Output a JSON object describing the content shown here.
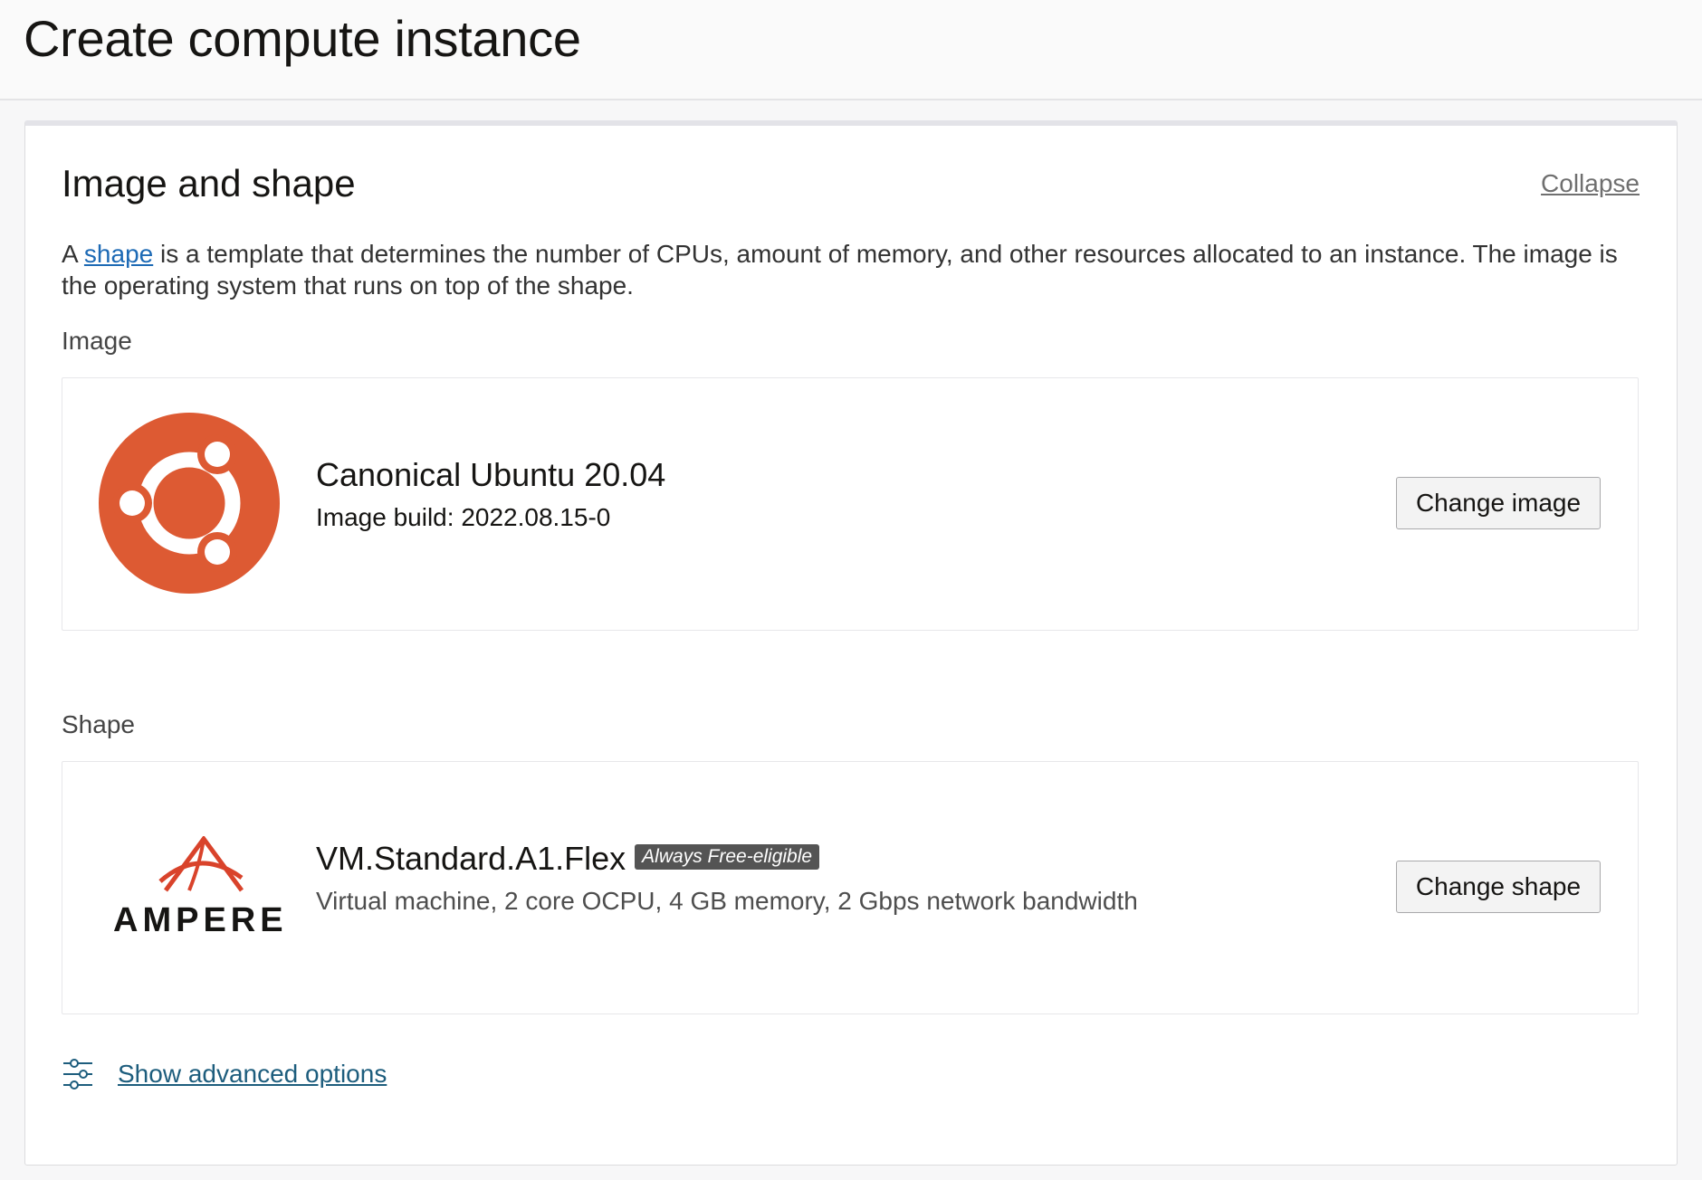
{
  "header": {
    "title": "Create compute instance"
  },
  "section": {
    "title": "Image and shape",
    "collapse_label": "Collapse",
    "description_prefix": "A ",
    "description_link": "shape",
    "description_suffix": " is a template that determines the number of CPUs, amount of memory, and other resources allocated to an instance. The image is the operating system that runs on top of the shape."
  },
  "image": {
    "label": "Image",
    "name": "Canonical Ubuntu 20.04",
    "build": "Image build: 2022.08.15-0",
    "change_label": "Change image",
    "logo_icon": "ubuntu-logo-icon",
    "logo_color": "#dd5a33"
  },
  "shape": {
    "label": "Shape",
    "name": "VM.Standard.A1.Flex",
    "badge": "Always Free-eligible",
    "details": "Virtual machine, 2 core OCPU, 4 GB memory, 2 Gbps network bandwidth",
    "change_label": "Change shape",
    "logo_text": "AMPERE",
    "logo_icon": "ampere-logo-icon",
    "logo_color": "#d9432b"
  },
  "advanced": {
    "label": "Show advanced options",
    "icon": "sliders-icon"
  }
}
